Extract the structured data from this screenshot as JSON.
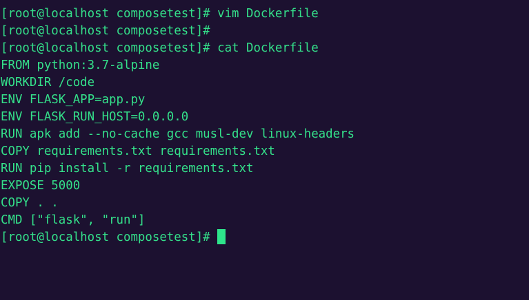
{
  "theme": {
    "background": "#1c1130",
    "foreground": "#34e08a",
    "cursor": "#2ee58b"
  },
  "terminal": {
    "lines": [
      "[root@localhost composetest]# vim Dockerfile",
      "[root@localhost composetest]#",
      "[root@localhost composetest]# cat Dockerfile",
      "FROM python:3.7-alpine",
      "WORKDIR /code",
      "ENV FLASK_APP=app.py",
      "ENV FLASK_RUN_HOST=0.0.0.0",
      "RUN apk add --no-cache gcc musl-dev linux-headers",
      "COPY requirements.txt requirements.txt",
      "RUN pip install -r requirements.txt",
      "EXPOSE 5000",
      "COPY . .",
      "CMD [\"flask\", \"run\"]"
    ],
    "prompt": "[root@localhost composetest]#"
  }
}
